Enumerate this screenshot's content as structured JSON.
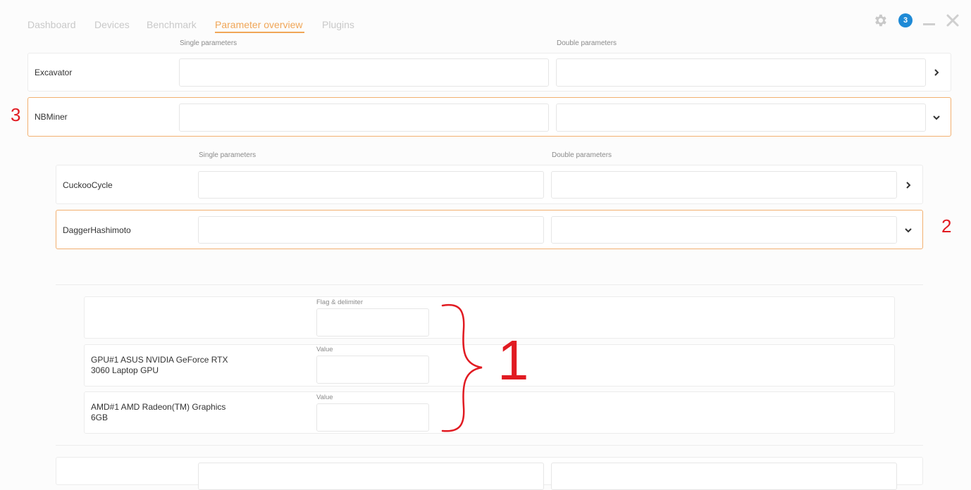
{
  "nav": {
    "tabs": [
      {
        "label": "Dashboard"
      },
      {
        "label": "Devices"
      },
      {
        "label": "Benchmark"
      },
      {
        "label": "Parameter overview"
      },
      {
        "label": "Plugins"
      }
    ]
  },
  "window": {
    "notification_count": "3",
    "icons": [
      "gear-icon",
      "notification-badge",
      "minimize-icon",
      "close-icon"
    ]
  },
  "plugins_section": {
    "single_header": "Single parameters",
    "double_header": "Double parameters",
    "rows": [
      {
        "name": "Excavator",
        "expanded": false,
        "single_value": "",
        "double_value": ""
      },
      {
        "name": "NBMiner",
        "expanded": true,
        "single_value": "",
        "double_value": ""
      }
    ]
  },
  "algorithms_section": {
    "single_header": "Single parameters",
    "double_header": "Double parameters",
    "rows": [
      {
        "name": "CuckooCycle",
        "expanded": false,
        "single_value": "",
        "double_value": ""
      },
      {
        "name": "DaggerHashimoto",
        "expanded": true,
        "single_value": "",
        "double_value": ""
      }
    ]
  },
  "devices_section": {
    "flag_row": {
      "label": "",
      "field_label": "Flag & delimiter",
      "value": ""
    },
    "device_rows": [
      {
        "name_line1": "GPU#1 ASUS NVIDIA GeForce RTX",
        "name_line2": "3060 Laptop GPU",
        "field_label": "Value",
        "value": ""
      },
      {
        "name_line1": "AMD#1 AMD Radeon(TM) Graphics",
        "name_line2": "6GB",
        "field_label": "Value",
        "value": ""
      }
    ]
  },
  "annotations": {
    "one": "1",
    "two": "2",
    "three": "3",
    "color": "#e11b22"
  },
  "colors": {
    "accent": "#f0a657",
    "badge": "#1e8ad6",
    "inactive_tab": "#c9c9c9"
  }
}
